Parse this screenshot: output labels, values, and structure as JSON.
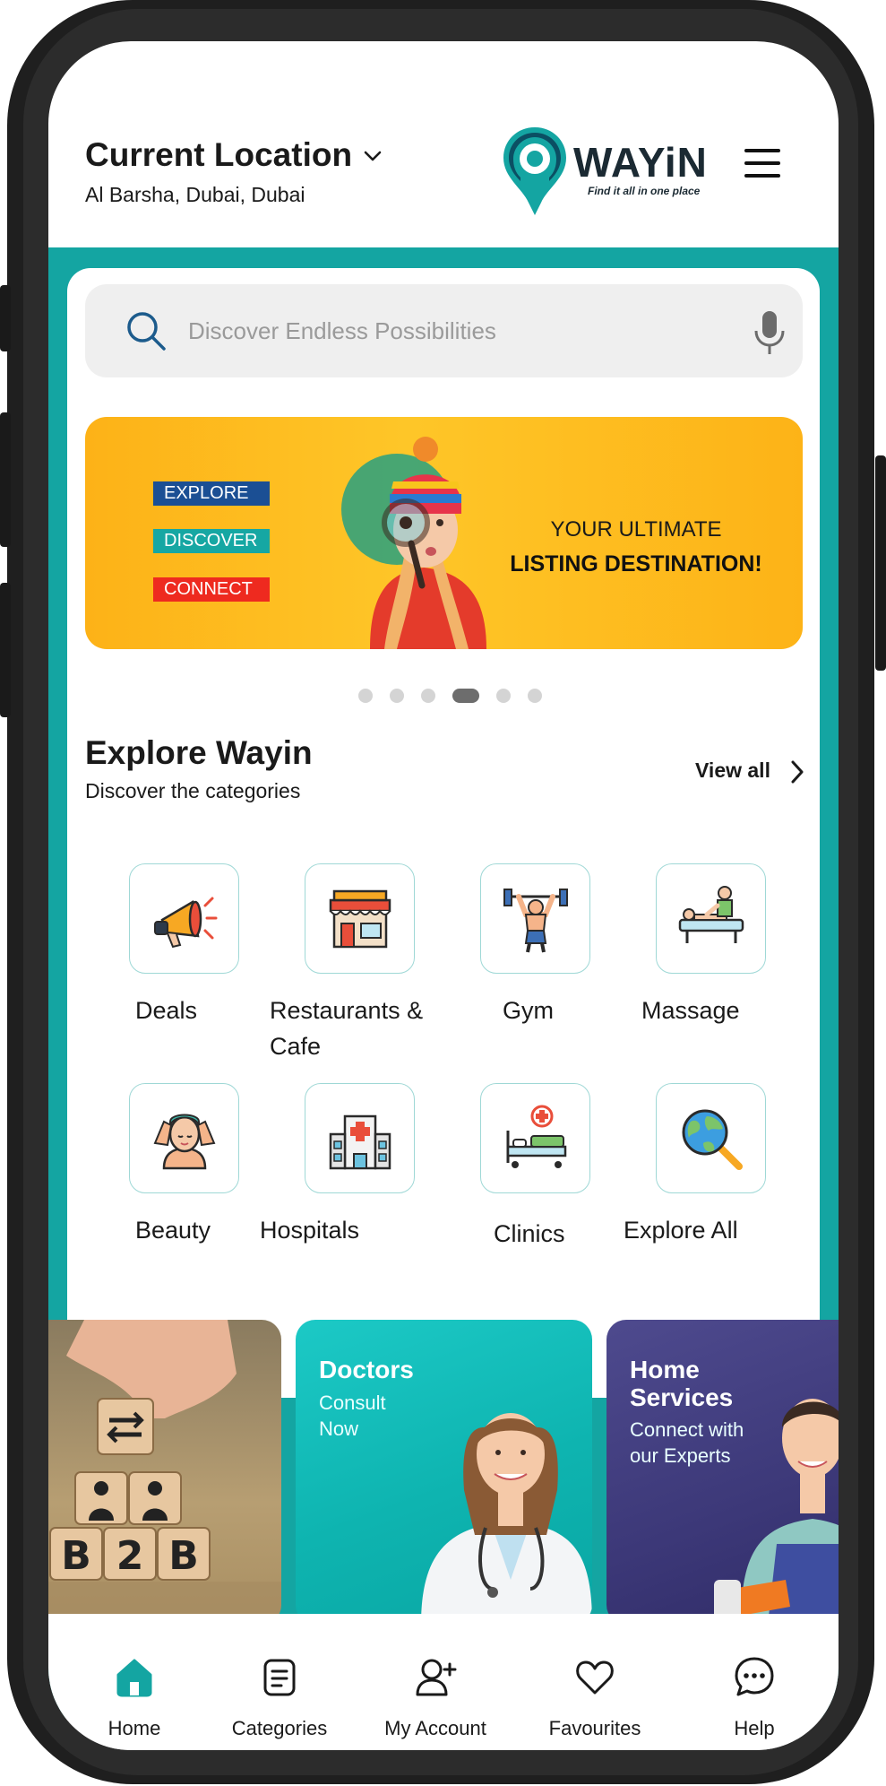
{
  "header": {
    "location_title": "Current Location",
    "location_address": "Al Barsha, Dubai, Dubai",
    "brand_name": "WAYiN",
    "brand_tagline": "Find it all in one place"
  },
  "search": {
    "placeholder": "Discover Endless Possibilities"
  },
  "banner": {
    "tags": [
      "EXPLORE",
      "DISCOVER",
      "CONNECT"
    ],
    "line1": "YOUR ULTIMATE",
    "line2": "LISTING DESTINATION!",
    "slide_count": 6,
    "active_slide": 4
  },
  "explore": {
    "title": "Explore Wayin",
    "subtitle": "Discover the categories",
    "view_all": "View all",
    "categories": [
      {
        "label": "Deals",
        "icon": "megaphone-icon"
      },
      {
        "label": "Restaurants & Cafe",
        "icon": "restaurant-icon"
      },
      {
        "label": "Gym",
        "icon": "weightlifter-icon"
      },
      {
        "label": "Massage",
        "icon": "massage-icon"
      },
      {
        "label": "Beauty",
        "icon": "face-care-icon"
      },
      {
        "label": "Hospitals",
        "icon": "hospital-icon"
      },
      {
        "label": "Clinics",
        "icon": "hospital-bed-icon"
      },
      {
        "label": "Explore All",
        "icon": "globe-search-icon"
      }
    ]
  },
  "tiles": {
    "b2b": {
      "label": "B2B"
    },
    "doctors": {
      "title": "Doctors",
      "subtitle_1": "Consult",
      "subtitle_2": "Now"
    },
    "home_services": {
      "title_1": "Home",
      "title_2": "Services",
      "subtitle_1": "Connect with",
      "subtitle_2": "our Experts"
    }
  },
  "nav": {
    "items": [
      {
        "label": "Home",
        "icon": "home-icon",
        "active": true
      },
      {
        "label": "Categories",
        "icon": "categories-icon",
        "active": false
      },
      {
        "label": "My Account",
        "icon": "add-user-icon",
        "active": false
      },
      {
        "label": "Favourites",
        "icon": "heart-icon",
        "active": false
      },
      {
        "label": "Help",
        "icon": "chat-help-icon",
        "active": false
      }
    ]
  },
  "colors": {
    "brand_teal": "#14a5a2",
    "banner_orange": "#fdb217",
    "tag_blue": "#1b4f94",
    "tag_red": "#ee2a1f",
    "home_services_purple": "#3c3878"
  }
}
